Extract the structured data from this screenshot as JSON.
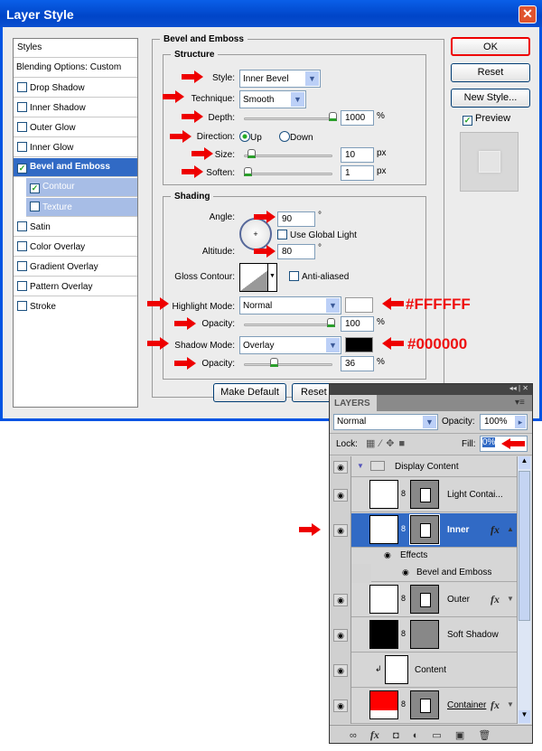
{
  "dialog": {
    "title": "Layer Style",
    "close": "✕"
  },
  "styles_list": [
    {
      "label": "Styles",
      "checkbox": false
    },
    {
      "label": "Blending Options: Custom",
      "checkbox": false
    },
    {
      "label": "Drop Shadow",
      "checkbox": true,
      "checked": false
    },
    {
      "label": "Inner Shadow",
      "checkbox": true,
      "checked": false
    },
    {
      "label": "Outer Glow",
      "checkbox": true,
      "checked": false
    },
    {
      "label": "Inner Glow",
      "checkbox": true,
      "checked": false
    },
    {
      "label": "Bevel and Emboss",
      "checkbox": true,
      "checked": true,
      "selected": true
    },
    {
      "label": "Contour",
      "checkbox": true,
      "checked": true
    },
    {
      "label": "Texture",
      "checkbox": true,
      "checked": false
    },
    {
      "label": "Satin",
      "checkbox": true,
      "checked": false
    },
    {
      "label": "Color Overlay",
      "checkbox": true,
      "checked": false
    },
    {
      "label": "Gradient Overlay",
      "checkbox": true,
      "checked": false
    },
    {
      "label": "Pattern Overlay",
      "checkbox": true,
      "checked": false
    },
    {
      "label": "Stroke",
      "checkbox": true,
      "checked": false
    }
  ],
  "buttons": {
    "ok": "OK",
    "reset": "Reset",
    "new_style": "New Style...",
    "preview": "Preview",
    "make_default": "Make Default",
    "reset_default": "Reset to Default"
  },
  "bevel": {
    "title": "Bevel and Emboss",
    "structure": {
      "title": "Structure",
      "style_label": "Style:",
      "style": "Inner Bevel",
      "technique_label": "Technique:",
      "technique": "Smooth",
      "depth_label": "Depth:",
      "depth": "1000",
      "depth_unit": "%",
      "direction_label": "Direction:",
      "up": "Up",
      "down": "Down",
      "size_label": "Size:",
      "size": "10",
      "size_unit": "px",
      "soften_label": "Soften:",
      "soften": "1",
      "soften_unit": "px"
    },
    "shading": {
      "title": "Shading",
      "angle_label": "Angle:",
      "angle": "90",
      "deg": "°",
      "global_light": "Use Global Light",
      "altitude_label": "Altitude:",
      "altitude": "80",
      "gloss_label": "Gloss Contour:",
      "anti_aliased": "Anti-aliased",
      "highlight_label": "Highlight Mode:",
      "highlight_mode": "Normal",
      "highlight_color": "#FFFFFF",
      "highlight_opacity_label": "Opacity:",
      "highlight_opacity": "100",
      "shadow_label": "Shadow Mode:",
      "shadow_mode": "Overlay",
      "shadow_color": "#000000",
      "shadow_opacity_label": "Opacity:",
      "shadow_opacity": "36",
      "pct": "%"
    }
  },
  "annotations": {
    "highlight_hex": "#FFFFFF",
    "shadow_hex": "#000000"
  },
  "layers": {
    "tab": "LAYERS",
    "blend_mode": "Normal",
    "opacity_label": "Opacity:",
    "opacity": "100%",
    "lock_label": "Lock:",
    "fill_label": "Fill:",
    "fill": "0%",
    "rows": [
      {
        "name": "Display Content",
        "type": "group"
      },
      {
        "name": "Light Contai...",
        "type": "layer"
      },
      {
        "name": "Inner",
        "type": "layer",
        "selected": true,
        "fx": true
      },
      {
        "name": "Effects",
        "type": "effects"
      },
      {
        "name": "Bevel and Emboss",
        "type": "effect"
      },
      {
        "name": "Outer",
        "type": "layer",
        "fx": true
      },
      {
        "name": "Soft Shadow",
        "type": "layer"
      },
      {
        "name": "Content",
        "type": "smart"
      },
      {
        "name": "Container",
        "type": "layer",
        "fx": true
      }
    ],
    "fx_label": "fx"
  }
}
